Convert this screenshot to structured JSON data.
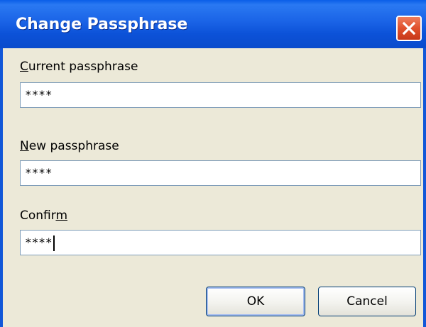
{
  "dialog": {
    "title": "Change Passphrase"
  },
  "fields": {
    "current": {
      "label_prefix": "",
      "label_accel": "C",
      "label_rest": "urrent passphrase",
      "value": "****"
    },
    "new": {
      "label_prefix": "",
      "label_accel": "N",
      "label_rest": "ew passphrase",
      "value": "****"
    },
    "confirm": {
      "label_prefix": "Confir",
      "label_accel": "m",
      "label_rest": "",
      "value": "****"
    }
  },
  "buttons": {
    "ok_label": "OK",
    "cancel_label": "Cancel"
  },
  "colors": {
    "titlebar": "#0a5ee8",
    "close_button": "#e0502c",
    "dialog_background": "#ece9d8",
    "field_border": "#7f9db9"
  },
  "icons": {
    "close": "close-icon"
  }
}
